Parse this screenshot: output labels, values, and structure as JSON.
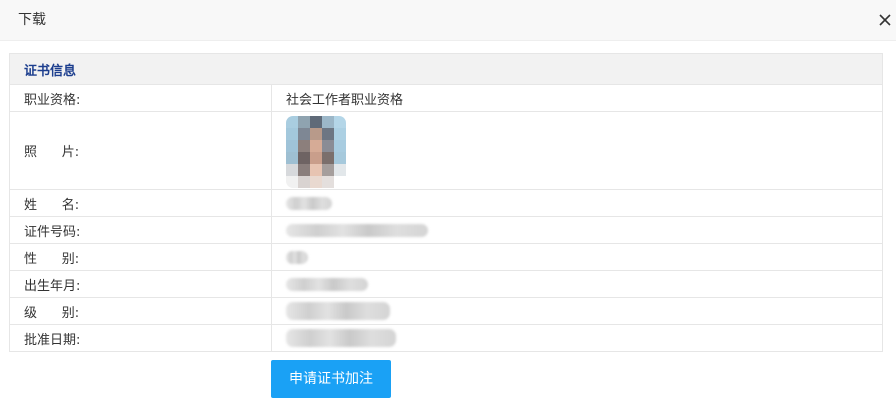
{
  "dialog": {
    "title": "下载",
    "close_icon": "close-icon"
  },
  "section": {
    "title": "证书信息"
  },
  "rows": [
    {
      "label": "职业资格:",
      "value": "社会工作者职业资格"
    },
    {
      "label": "照      片:",
      "value": ""
    },
    {
      "label": "姓      名:",
      "value": ""
    },
    {
      "label": "证件号码:",
      "value": ""
    },
    {
      "label": "性      别:",
      "value": ""
    },
    {
      "label": "出生年月:",
      "value": ""
    },
    {
      "label": "级      别:",
      "value": ""
    },
    {
      "label": "批准日期:",
      "value": ""
    }
  ],
  "apply_button": {
    "label": "申请证书加注",
    "color": "#1aa1f5"
  },
  "colors": {
    "section_title": "#1c3e8e",
    "border": "#e6e6e6",
    "header_bg": "#f2f2f2"
  }
}
